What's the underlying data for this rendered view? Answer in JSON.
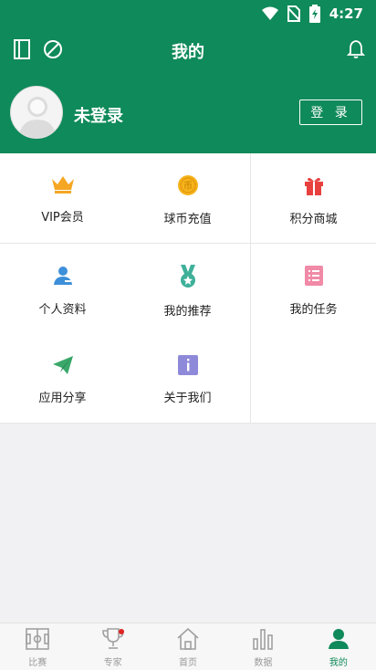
{
  "status_bar": {
    "time": "4:27"
  },
  "header": {
    "title": "我的"
  },
  "profile": {
    "name": "未登录",
    "login_label": "登 录"
  },
  "menu": [
    {
      "label": "VIP会员",
      "icon": "crown-icon",
      "color": "#f5a623"
    },
    {
      "label": "球币充值",
      "icon": "coin-icon",
      "color": "#f5b31b"
    },
    {
      "label": "积分商城",
      "icon": "gift-icon",
      "color": "#e8403f"
    },
    {
      "label": "个人资料",
      "icon": "profile-card-icon",
      "color": "#3d8fd9"
    },
    {
      "label": "我的推荐",
      "icon": "medal-icon",
      "color": "#3fb09a"
    },
    {
      "label": "我的任务",
      "icon": "task-list-icon",
      "color": "#f08aa6"
    },
    {
      "label": "应用分享",
      "icon": "paper-plane-icon",
      "color": "#3aa86a"
    },
    {
      "label": "关于我们",
      "icon": "info-icon",
      "color": "#8e8ad9"
    }
  ],
  "bottom_nav": [
    {
      "label": "比赛",
      "icon": "pitch-icon",
      "active": false
    },
    {
      "label": "专家",
      "icon": "trophy-icon",
      "active": false,
      "badge": true
    },
    {
      "label": "首页",
      "icon": "home-icon",
      "active": false
    },
    {
      "label": "数据",
      "icon": "bar-chart-icon",
      "active": false
    },
    {
      "label": "我的",
      "icon": "user-icon",
      "active": true
    }
  ],
  "colors": {
    "brand": "#0f8a5a",
    "inactive": "#9a9a9a"
  }
}
